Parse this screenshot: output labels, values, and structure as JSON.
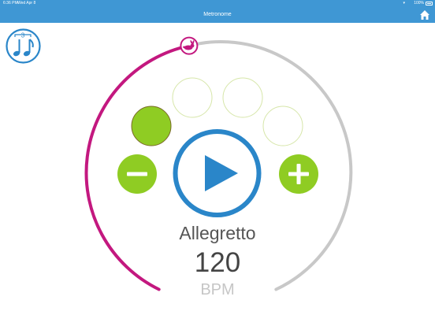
{
  "status_bar": {
    "time": "6:36 PM",
    "date": "Wed Apr 8",
    "battery": "100%"
  },
  "nav": {
    "title": "Metronome",
    "home_icon": "home-icon"
  },
  "rhythm_button": {
    "icon": "triplet-notes-icon",
    "tuplet_label": "3"
  },
  "tempo": {
    "marking": "Allegretto",
    "bpm": "120",
    "unit": "BPM",
    "slider_icon": "rabbit-icon"
  },
  "beats": [
    {
      "active": true
    },
    {
      "active": false
    },
    {
      "active": false
    },
    {
      "active": false
    }
  ],
  "controls": {
    "decrease_icon": "minus-icon",
    "play_icon": "play-icon",
    "increase_icon": "plus-icon"
  },
  "colors": {
    "header": "#3f97d4",
    "accent_blue": "#2a86c9",
    "beat_green": "#8fcc23",
    "progress_magenta": "#c3187f",
    "track_gray": "#c8c8c8"
  }
}
